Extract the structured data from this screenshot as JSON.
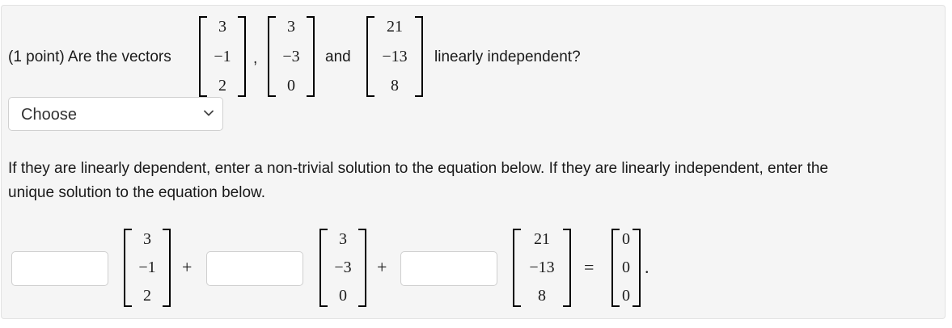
{
  "question": {
    "prefix": "(1 point) Are the vectors",
    "comma": ",",
    "and": "and",
    "suffix": "linearly independent?"
  },
  "vectors": [
    [
      "3",
      "−1",
      "2"
    ],
    [
      "3",
      "−3",
      "0"
    ],
    [
      "21",
      "−13",
      "8"
    ]
  ],
  "select": {
    "selected": "Choose"
  },
  "instructions": {
    "line1": "If they are linearly dependent, enter a non-trivial solution to the equation below. If they are linearly independent, enter the",
    "line2": "unique solution to the equation below."
  },
  "equation": {
    "plus": "+",
    "equals": "=",
    "period": ".",
    "zero_vector": [
      "0",
      "0",
      "0"
    ]
  },
  "inputs": [
    {
      "value": ""
    },
    {
      "value": ""
    },
    {
      "value": ""
    }
  ]
}
